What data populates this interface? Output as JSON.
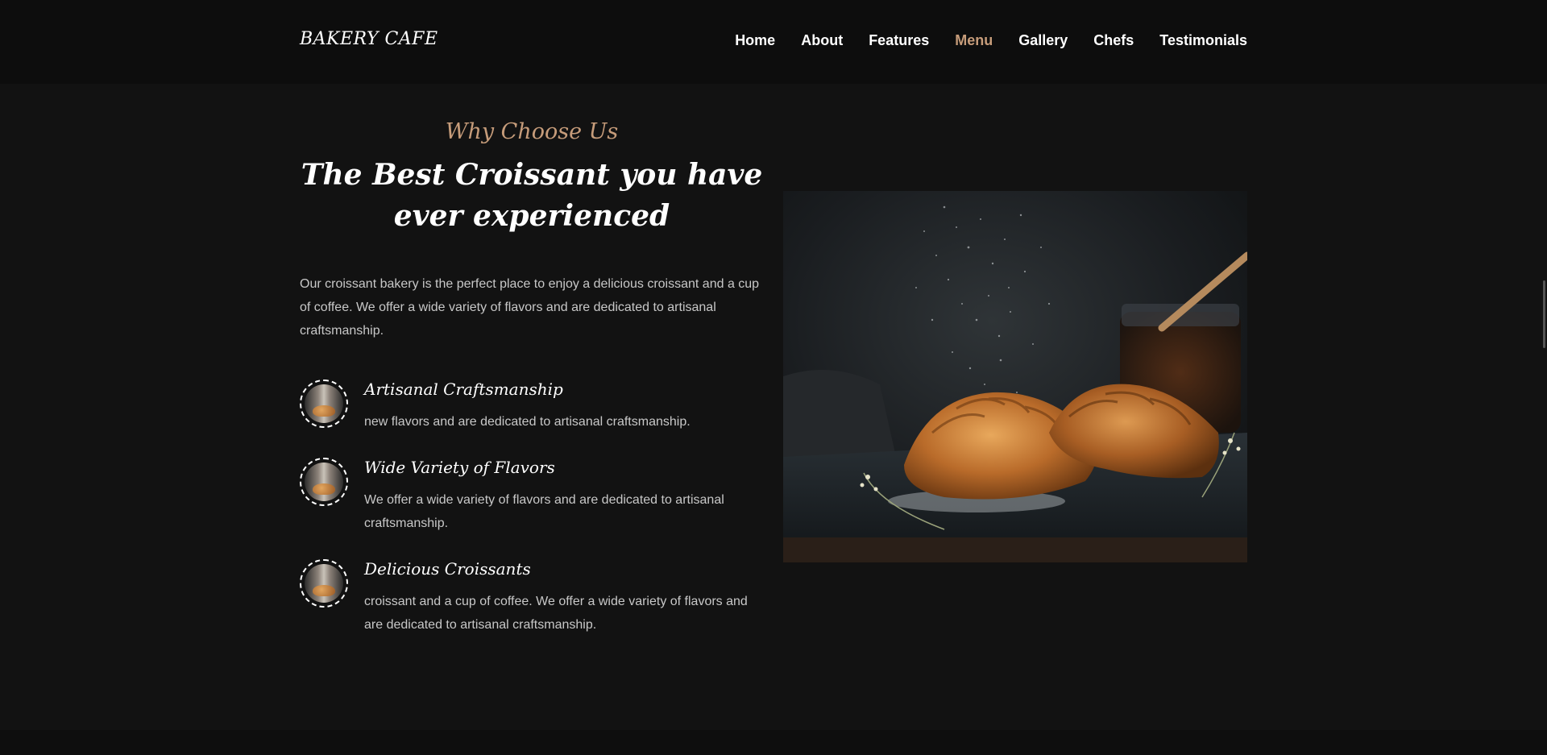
{
  "header": {
    "logo": "BAKERY CAFE",
    "nav": [
      {
        "label": "Home",
        "active": false
      },
      {
        "label": "About",
        "active": false
      },
      {
        "label": "Features",
        "active": false
      },
      {
        "label": "Menu",
        "active": true
      },
      {
        "label": "Gallery",
        "active": false
      },
      {
        "label": "Chefs",
        "active": false
      },
      {
        "label": "Testimonials",
        "active": false
      }
    ]
  },
  "about": {
    "eyebrow": "Why Choose Us",
    "headline": "The Best Croissant you have ever experienced",
    "intro": "Our croissant bakery is the perfect place to enjoy a delicious croissant and a cup of coffee. We offer a wide variety of flavors and are dedicated to artisanal craftsmanship.",
    "features": [
      {
        "title": "Artisanal Craftsmanship",
        "description": "new flavors and are dedicated to artisanal craftsmanship.",
        "icon": "croissant-thumbnail-icon"
      },
      {
        "title": "Wide Variety of Flavors",
        "description": "We offer a wide variety of flavors and are dedicated to artisanal craftsmanship.",
        "icon": "croissant-thumbnail-icon"
      },
      {
        "title": "Delicious Croissants",
        "description": "croissant and a cup of coffee. We offer a wide variety of flavors and are dedicated to artisanal craftsmanship.",
        "icon": "croissant-thumbnail-icon"
      }
    ]
  },
  "colors": {
    "accent": "#c69c7a",
    "background": "#121212",
    "header_background": "#0d0d0d",
    "body_text": "#c8c8c8"
  }
}
